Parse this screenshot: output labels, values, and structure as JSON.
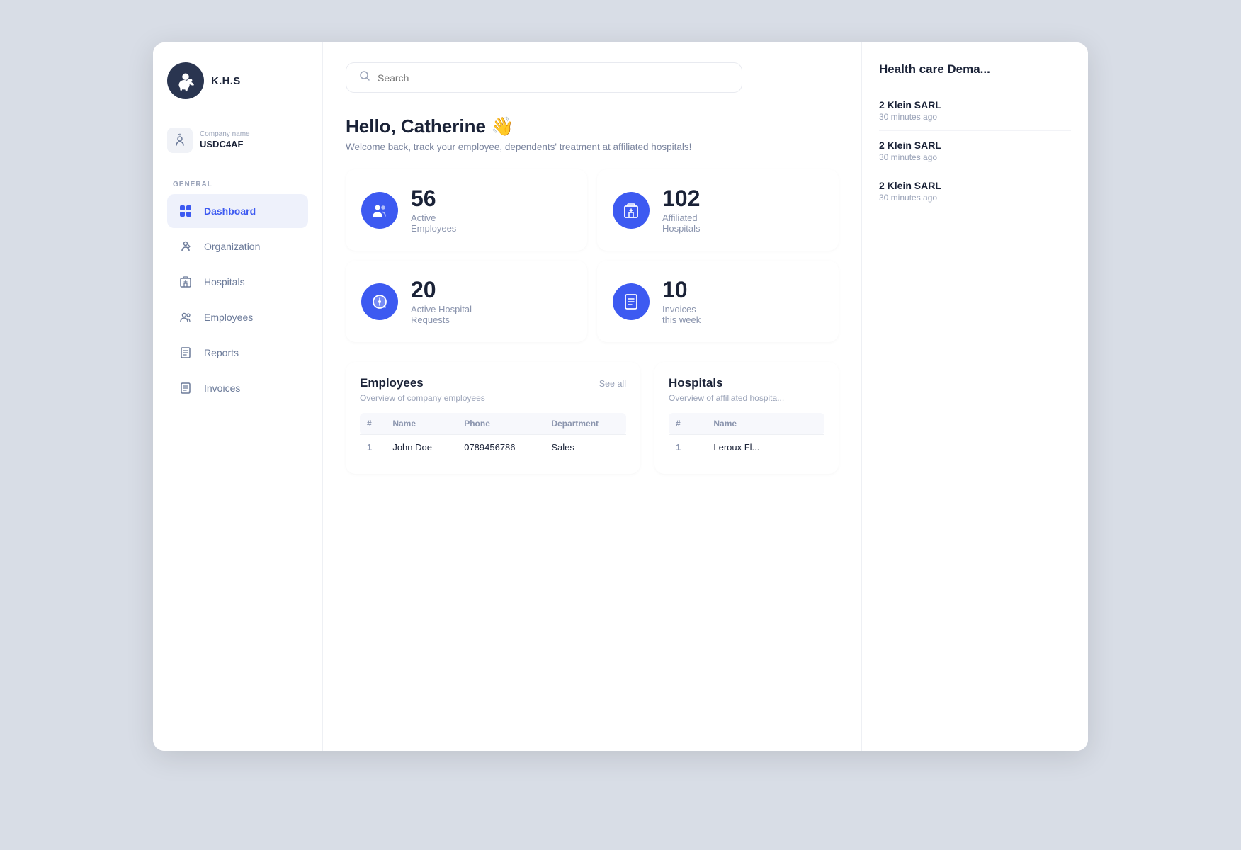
{
  "sidebar": {
    "logo_text": "K.H.S",
    "company_label": "Company name",
    "company_name": "USDC4AF",
    "section_general": "GENERAL",
    "nav_items": [
      {
        "id": "dashboard",
        "label": "Dashboard",
        "active": true
      },
      {
        "id": "organization",
        "label": "Organization",
        "active": false
      },
      {
        "id": "hospitals",
        "label": "Hospitals",
        "active": false
      },
      {
        "id": "employees",
        "label": "Employees",
        "active": false
      },
      {
        "id": "reports",
        "label": "Reports",
        "active": false
      },
      {
        "id": "invoices",
        "label": "Invoices",
        "active": false
      }
    ]
  },
  "search": {
    "placeholder": "Search"
  },
  "greeting": {
    "title": "Hello, Catherine 👋",
    "subtitle": "Welcome back, track your employee, dependents' treatment at affiliated hospitals!"
  },
  "stats": [
    {
      "number": "56",
      "label": "Active\nEmployees",
      "icon": "👥"
    },
    {
      "number": "102",
      "label": "Affiliated\nHospitals",
      "icon": "🏥"
    },
    {
      "number": "20",
      "label": "Active Hospital\nRequests",
      "icon": "💬"
    },
    {
      "number": "10",
      "label": "Invoices\nthis week",
      "icon": "📋"
    }
  ],
  "health_care": {
    "title": "Health care Dema...",
    "items": [
      {
        "name": "2 Klein SARL",
        "time": "30 minutes ago"
      },
      {
        "name": "2 Klein SARL",
        "time": "30 minutes ago"
      },
      {
        "name": "2 Klein SARL",
        "time": "30 minutes ago"
      }
    ]
  },
  "employees_table": {
    "title": "Employees",
    "subtitle": "Overview of company employees",
    "see_all": "See all",
    "columns": [
      "#",
      "Name",
      "Phone",
      "Department"
    ],
    "rows": [
      {
        "num": "1",
        "name": "John Doe",
        "phone": "0789456786",
        "dept": "Sales"
      }
    ]
  },
  "hospitals_table": {
    "title": "Hospitals",
    "subtitle": "Overview of affiliated hospita...",
    "columns": [
      "#",
      "Name"
    ],
    "rows": [
      {
        "num": "1",
        "name": "Leroux Fl..."
      }
    ]
  }
}
